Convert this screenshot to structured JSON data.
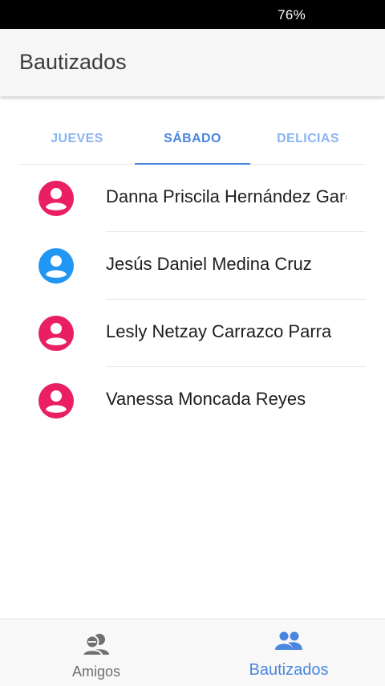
{
  "status_bar": {
    "battery": "76%"
  },
  "app_bar": {
    "title": "Bautizados"
  },
  "tabs": [
    {
      "label": "JUEVES",
      "active": false
    },
    {
      "label": "SÁBADO",
      "active": true
    },
    {
      "label": "DELICIAS",
      "active": false
    }
  ],
  "people": [
    {
      "name": "Danna Priscila Hernández García",
      "avatar_icon": "person-icon",
      "avatar_color": "#e91e63"
    },
    {
      "name": "Jesús Daniel Medina Cruz",
      "avatar_icon": "person-icon",
      "avatar_color": "#2196f3"
    },
    {
      "name": "Lesly Netzay Carrazco Parra",
      "avatar_icon": "person-icon",
      "avatar_color": "#e91e63"
    },
    {
      "name": "Vanessa Moncada Reyes",
      "avatar_icon": "person-icon",
      "avatar_color": "#e91e63"
    }
  ],
  "bottom_nav": {
    "amigos": {
      "label": "Amigos",
      "icon": "friends-icon",
      "active": false
    },
    "bautizados": {
      "label": "Bautizados",
      "icon": "people-icon",
      "active": true
    }
  },
  "colors": {
    "accent": "#4a86e0",
    "female": "#e91e63",
    "male": "#2196f3"
  }
}
